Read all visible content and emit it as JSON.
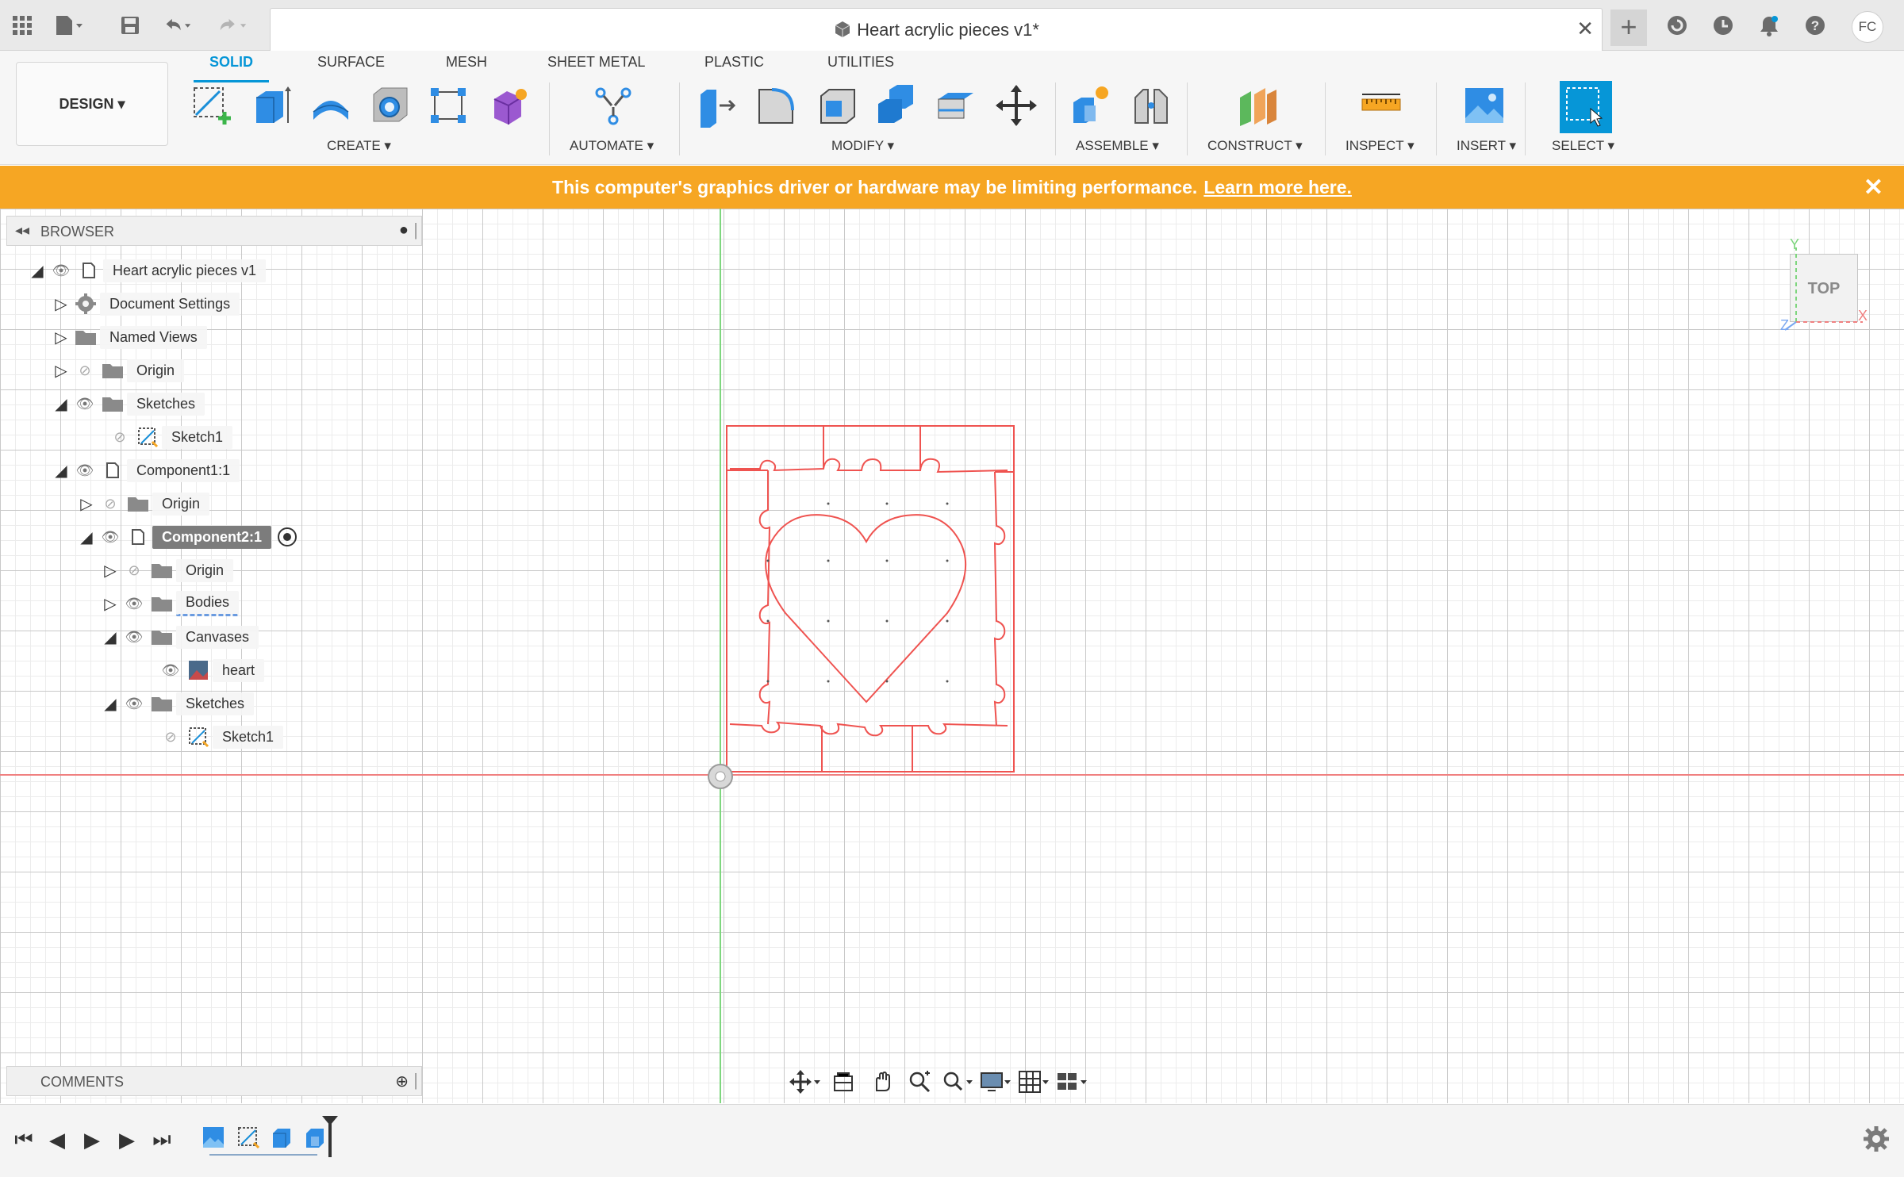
{
  "window": {
    "document_title": "Heart acrylic pieces v1*",
    "avatar_initials": "FC"
  },
  "ribbon": {
    "workspace_button": "DESIGN",
    "tabs": [
      "SOLID",
      "SURFACE",
      "MESH",
      "SHEET METAL",
      "PLASTIC",
      "UTILITIES"
    ],
    "active_tab": "SOLID",
    "groups": [
      "CREATE",
      "AUTOMATE",
      "MODIFY",
      "ASSEMBLE",
      "CONSTRUCT",
      "INSPECT",
      "INSERT",
      "SELECT"
    ]
  },
  "banner": {
    "message": "This computer's graphics driver or hardware may be limiting performance.",
    "link": "Learn more here."
  },
  "browser": {
    "title": "BROWSER",
    "items": [
      {
        "label": "Heart acrylic pieces v1"
      },
      {
        "label": "Document Settings"
      },
      {
        "label": "Named Views"
      },
      {
        "label": "Origin"
      },
      {
        "label": "Sketches"
      },
      {
        "label": "Sketch1"
      },
      {
        "label": "Component1:1"
      },
      {
        "label": "Origin"
      },
      {
        "label": "Component2:1"
      },
      {
        "label": "Origin"
      },
      {
        "label": "Bodies"
      },
      {
        "label": "Canvases"
      },
      {
        "label": "heart"
      },
      {
        "label": "Sketches"
      },
      {
        "label": "Sketch1"
      }
    ]
  },
  "comments": {
    "title": "COMMENTS"
  },
  "viewcube": {
    "face": "TOP",
    "axis_x": "X",
    "axis_y": "Y",
    "axis_z": "Z"
  },
  "colors": {
    "accent": "#0696d7",
    "banner": "#f6a623",
    "sketch_line": "#ef5350",
    "x_axis": "#f08080",
    "y_axis": "#7ed67e"
  }
}
